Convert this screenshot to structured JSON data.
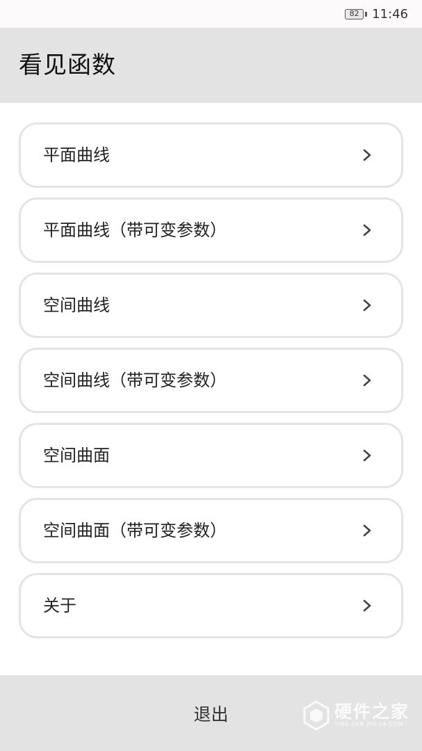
{
  "status_bar": {
    "battery_level": "82",
    "time": "11:46"
  },
  "app_bar": {
    "title": "看见函数"
  },
  "menu": {
    "items": [
      {
        "label": "平面曲线",
        "icon": "chevron-right-icon"
      },
      {
        "label": "平面曲线（带可变参数）",
        "icon": "chevron-right-icon"
      },
      {
        "label": "空间曲线",
        "icon": "chevron-right-icon"
      },
      {
        "label": "空间曲线（带可变参数）",
        "icon": "chevron-right-icon"
      },
      {
        "label": "空间曲面",
        "icon": "chevron-right-icon"
      },
      {
        "label": "空间曲面（带可变参数）",
        "icon": "chevron-right-icon"
      },
      {
        "label": "关于",
        "icon": "chevron-right-icon"
      }
    ]
  },
  "bottom_bar": {
    "exit_label": "退出"
  },
  "watermark": {
    "brand": "硬件之家",
    "url": "YING JIAN ZHI JIA.COM"
  },
  "colors": {
    "app_bar_bg": "#e3e3e3",
    "card_border": "#e4e4e4",
    "status_bar_bg": "#fdfafc"
  }
}
